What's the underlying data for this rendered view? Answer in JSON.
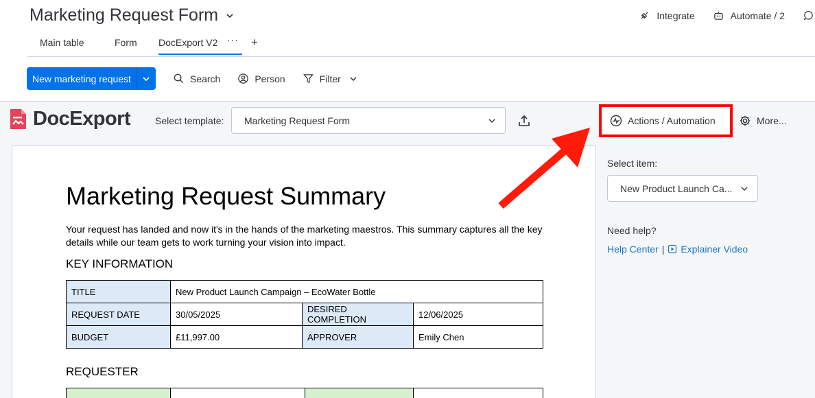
{
  "header": {
    "board_title": "Marketing Request Form",
    "integrate_label": "Integrate",
    "automate_label": "Automate / 2"
  },
  "tabs": [
    {
      "label": "Main table"
    },
    {
      "label": "Form"
    },
    {
      "label": "DocExport V2",
      "active": true
    }
  ],
  "toolbar": {
    "new_button_label": "New marketing request",
    "search_label": "Search",
    "person_label": "Person",
    "filter_label": "Filter"
  },
  "docexport": {
    "logo_text": "DocExport",
    "select_template_label": "Select template:",
    "template_value": "Marketing Request Form",
    "actions_label": "Actions / Automation",
    "more_label": "More..."
  },
  "document": {
    "title": "Marketing Request Summary",
    "intro": "Your request has landed and now it's in the hands of the marketing maestros. This summary captures all the key details while our team gets to work turning your vision into impact.",
    "key_info_heading": "KEY INFORMATION",
    "key_info": {
      "title_label": "TITLE",
      "title_value": "New Product Launch Campaign – EcoWater Bottle",
      "request_date_label": "REQUEST DATE",
      "request_date_value": "30/05/2025",
      "desired_completion_label": "DESIRED COMPLETION",
      "desired_completion_value": "12/06/2025",
      "budget_label": "BUDGET",
      "budget_value": "£11,997.00",
      "approver_label": "APPROVER",
      "approver_value": "Emily Chen"
    },
    "requester_heading": "REQUESTER"
  },
  "sidebar": {
    "select_item_label": "Select item:",
    "item_value": "New Product Launch Ca...",
    "need_help_label": "Need help?",
    "help_center_link": "Help Center",
    "separator": "|",
    "explainer_video_link": "Explainer Video"
  },
  "colors": {
    "primary_blue": "#0073ea",
    "highlight_red": "#ff0000",
    "link_blue": "#1f76c2",
    "logo_red": "#e2445c"
  }
}
